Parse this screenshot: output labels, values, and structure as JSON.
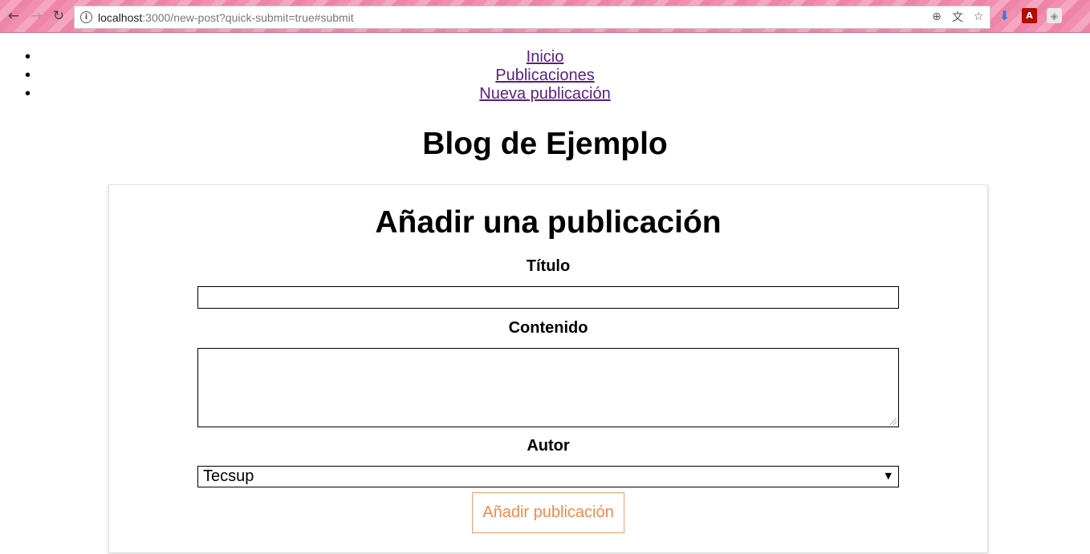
{
  "browser": {
    "url_host": "localhost",
    "url_rest": ":3000/new-post?quick-submit=true#submit",
    "icons": [
      "back-arrow-icon",
      "forward-arrow-icon",
      "reload-icon",
      "info-icon",
      "zoom-icon",
      "translate-icon",
      "star-icon",
      "download-extension-icon",
      "pdf-extension-icon",
      "cube-extension-icon"
    ]
  },
  "nav": {
    "items": [
      {
        "label": "Inicio"
      },
      {
        "label": "Publicaciones"
      },
      {
        "label": "Nueva publicación"
      }
    ]
  },
  "site": {
    "title": "Blog de Ejemplo"
  },
  "form": {
    "title": "Añadir una publicación",
    "title_label": "Título",
    "title_value": "",
    "content_label": "Contenido",
    "content_value": "",
    "author_label": "Autor",
    "author_selected": "Tecsup",
    "submit_label": "Añadir publicación"
  },
  "colors": {
    "link": "#5a1f7e",
    "button_text": "#f08a4b",
    "button_border": "#f0a070",
    "chrome_bg": "#f4a6c2"
  }
}
